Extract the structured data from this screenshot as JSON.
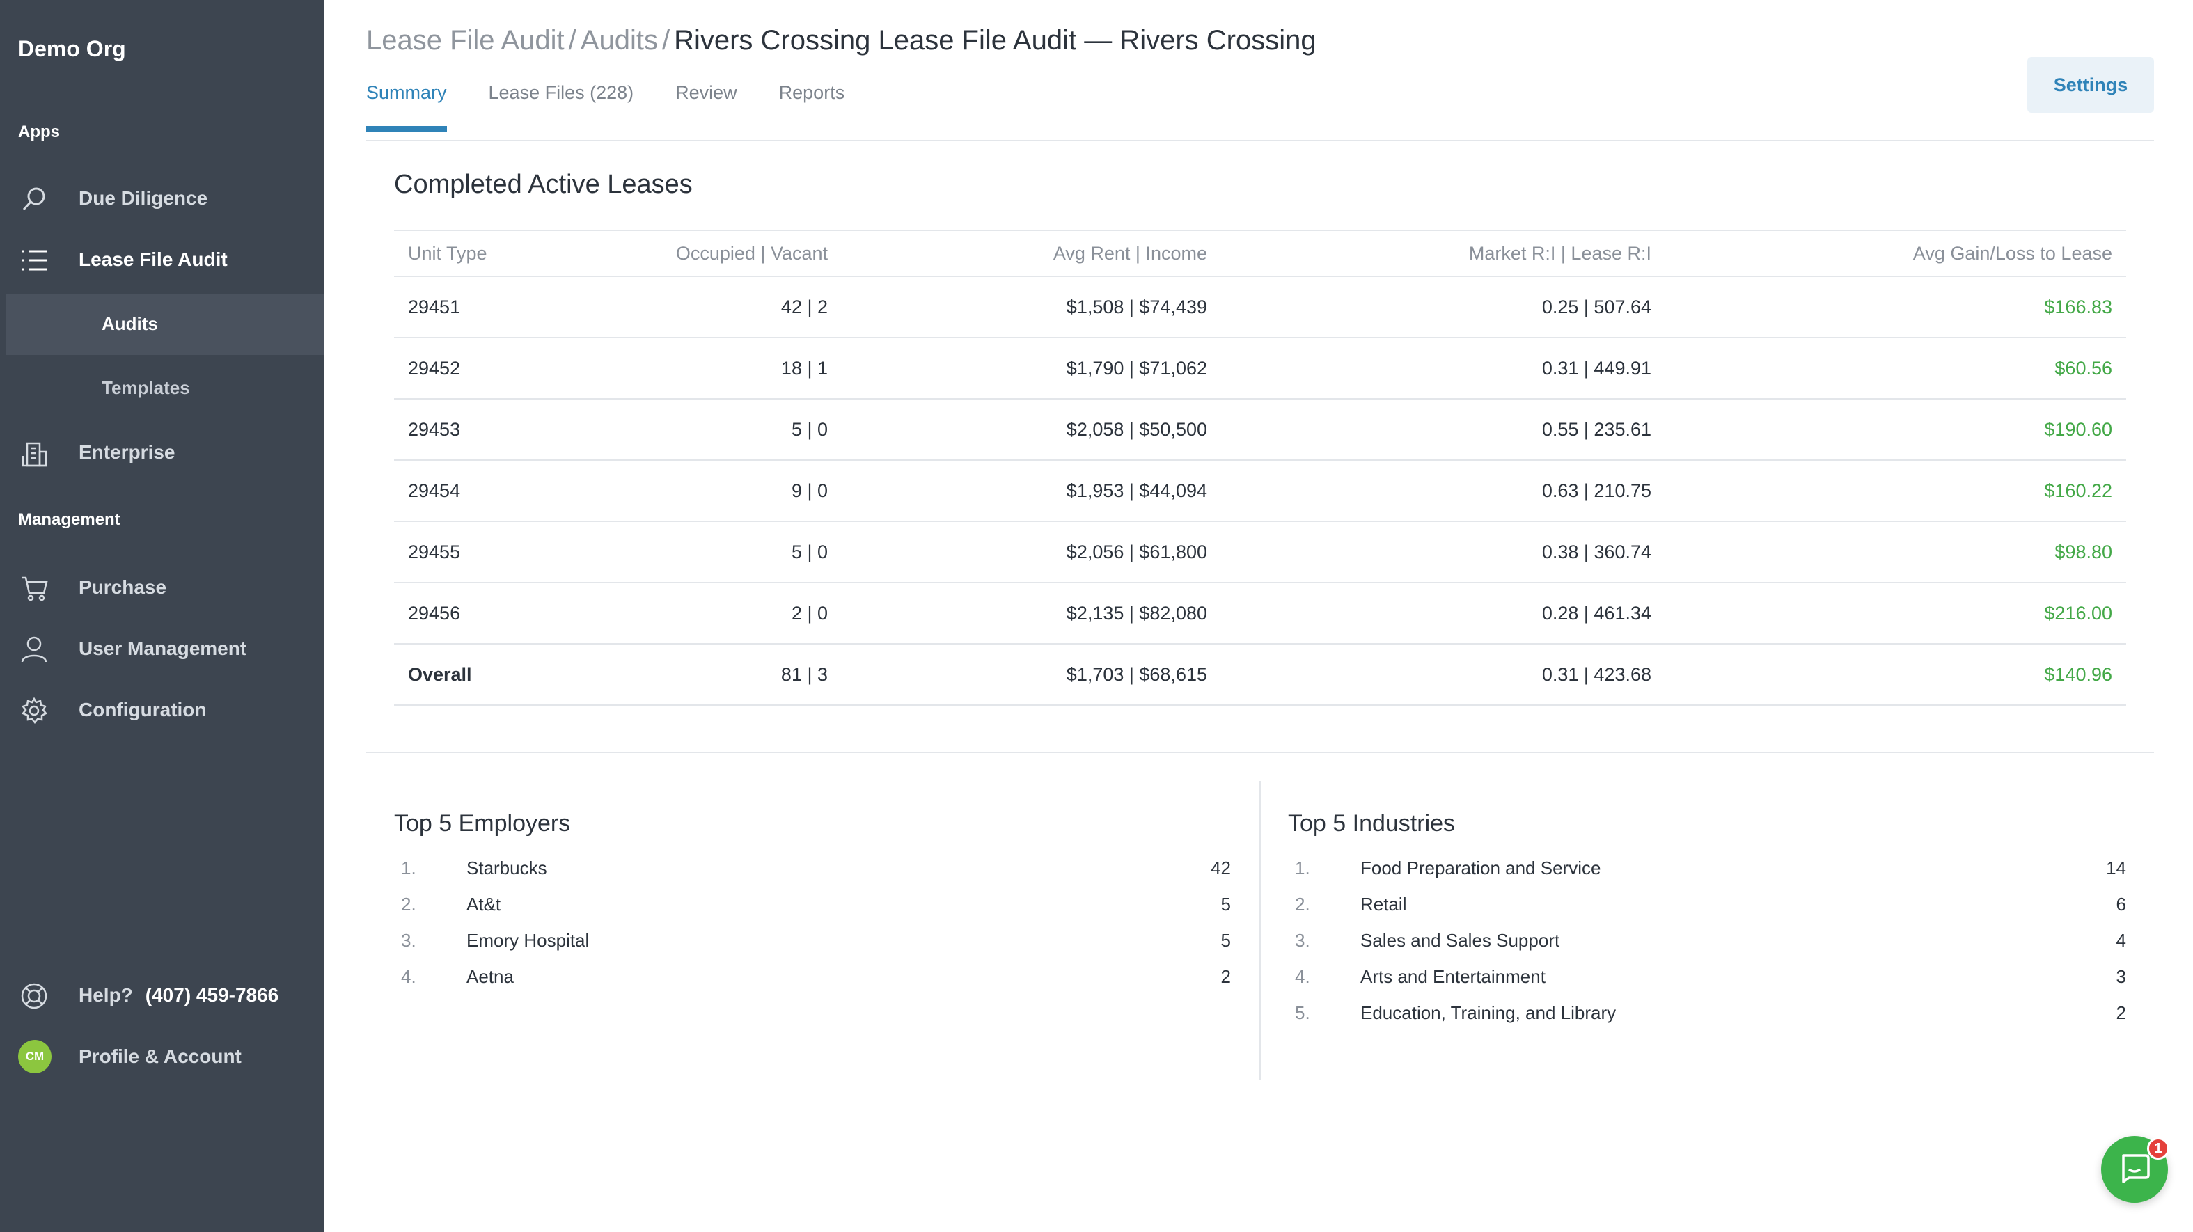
{
  "org_name": "Demo Org",
  "sidebar": {
    "apps_label": "Apps",
    "management_label": "Management",
    "due_diligence": "Due Diligence",
    "lease_file_audit": "Lease File Audit",
    "audits": "Audits",
    "templates": "Templates",
    "enterprise": "Enterprise",
    "purchase": "Purchase",
    "user_management": "User Management",
    "configuration": "Configuration",
    "help_label": "Help?",
    "help_phone": "(407) 459-7866",
    "profile_label": "Profile & Account",
    "avatar_initials": "CM"
  },
  "breadcrumb": {
    "level1": "Lease File Audit",
    "level2": "Audits",
    "current": "Rivers Crossing Lease File Audit — Rivers Crossing"
  },
  "settings_label": "Settings",
  "tabs": [
    "Summary",
    "Lease Files (228)",
    "Review",
    "Reports"
  ],
  "table": {
    "title": "Completed Active Leases",
    "headers": [
      "Unit Type",
      "Occupied | Vacant",
      "Avg Rent | Income",
      "Market R:I | Lease R:I",
      "Avg Gain/Loss to Lease"
    ],
    "rows": [
      [
        "29451",
        "42 | 2",
        "$1,508  |  $74,439",
        "0.25  |  507.64",
        "$166.83"
      ],
      [
        "29452",
        "18 | 1",
        "$1,790  |  $71,062",
        "0.31  |  449.91",
        "$60.56"
      ],
      [
        "29453",
        "5 | 0",
        "$2,058  |  $50,500",
        "0.55  |  235.61",
        "$190.60"
      ],
      [
        "29454",
        "9 | 0",
        "$1,953  |  $44,094",
        "0.63  |  210.75",
        "$160.22"
      ],
      [
        "29455",
        "5 | 0",
        "$2,056  |  $61,800",
        "0.38  |  360.74",
        "$98.80"
      ],
      [
        "29456",
        "2 | 0",
        "$2,135  |  $82,080",
        "0.28  |  461.34",
        "$216.00"
      ]
    ],
    "overall": [
      "Overall",
      "81 | 3",
      "$1,703  |  $68,615",
      "0.31  |  423.68",
      "$140.96"
    ]
  },
  "top_employers": {
    "title": "Top 5 Employers",
    "items": [
      {
        "rank": "1.",
        "name": "Starbucks",
        "count": "42"
      },
      {
        "rank": "2.",
        "name": "At&t",
        "count": "5"
      },
      {
        "rank": "3.",
        "name": "Emory Hospital",
        "count": "5"
      },
      {
        "rank": "4.",
        "name": "Aetna",
        "count": "2"
      }
    ]
  },
  "top_industries": {
    "title": "Top 5 Industries",
    "items": [
      {
        "rank": "1.",
        "name": "Food Preparation and Service",
        "count": "14"
      },
      {
        "rank": "2.",
        "name": "Retail",
        "count": "6"
      },
      {
        "rank": "3.",
        "name": "Sales and Sales Support",
        "count": "4"
      },
      {
        "rank": "4.",
        "name": "Arts and Entertainment",
        "count": "3"
      },
      {
        "rank": "5.",
        "name": "Education, Training, and Library",
        "count": "2"
      }
    ]
  },
  "chat_badge_count": "1",
  "colors": {
    "sidebar_bg": "#3d4550",
    "accent": "#2f83b8",
    "gain_green": "#43a847",
    "avatar_green": "#8cc63f",
    "chat_green": "#3cb44b",
    "badge_red": "#e4413b"
  },
  "icons": {
    "due_diligence": "search-icon",
    "lease_file_audit": "list-icon",
    "enterprise": "building-icon",
    "purchase": "cart-icon",
    "user_management": "user-icon",
    "configuration": "gear-icon",
    "help": "lifebuoy-icon",
    "chat": "chat-icon"
  }
}
